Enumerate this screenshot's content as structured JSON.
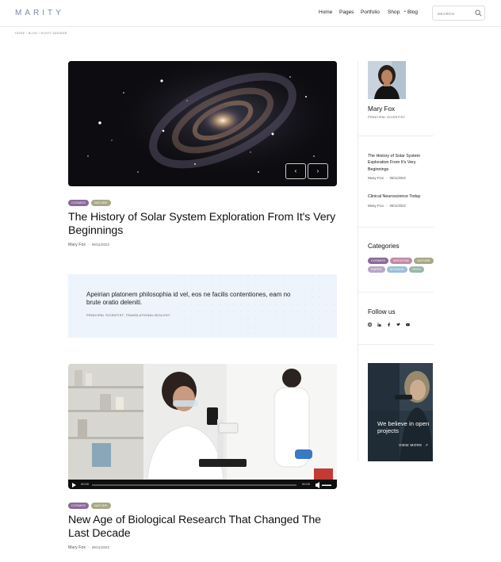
{
  "header": {
    "logo": "MARITY",
    "nav": [
      "Home",
      "Pages",
      "Portfolio",
      "Shop",
      "Blog"
    ],
    "search_placeholder": "SEARCH"
  },
  "breadcrumb": "HOME / BLOG / RIGHT SIDEBAR",
  "posts": [
    {
      "tags": [
        "COSMOS",
        "NATURE"
      ],
      "title": "The History of Solar System Exploration From It's Very Beginnings",
      "author": "Mary Fox",
      "date": "06/11/2022"
    },
    {
      "tags": [
        "COSMOS",
        "NATURE"
      ],
      "title": "New Age of Biological Research That Changed The Last Decade",
      "author": "Mary Fox",
      "date": "06/11/2022"
    }
  ],
  "quote": {
    "text": "Apeirian platonem philosophia id vel, eos ne facilis contentiones, eam no brute oratio deleniti.",
    "author": "PRINCIPAL SCIENTIST, TRANSLATIONAL BIOLOGY"
  },
  "video": {
    "current_time": "00:00",
    "duration": "00:00"
  },
  "sidebar": {
    "author_name": "Mary Fox",
    "author_role": "PRINCIPAL SCIENTIST",
    "recent_posts": [
      {
        "title": "The History of Solar System Exploration From It's Very Beginnings",
        "author": "Mary Fox",
        "date": "06/11/2022"
      },
      {
        "title": "Clinical Neuroscience Today",
        "author": "Mary Fox",
        "date": "06/11/2022"
      }
    ],
    "categories_heading": "Categories",
    "categories": [
      "COSMOS",
      "MEDICINE",
      "NATURE",
      "PAPER",
      "SCIENCE",
      "TECH"
    ],
    "follow_heading": "Follow us",
    "social": [
      "instagram-icon",
      "linkedin-icon",
      "facebook-icon",
      "twitter-icon",
      "youtube-icon"
    ],
    "promo_text": "We believe in open projects",
    "promo_link": "VIEW MORE"
  },
  "colors": {
    "cosmos": "#8a6a9a",
    "nature": "#a8a888",
    "medicine": "#c28aa6",
    "paper": "#b7a6c6",
    "science": "#9bc0d8",
    "tech": "#9ab7a8",
    "quote_bg": "#eef4fc"
  }
}
